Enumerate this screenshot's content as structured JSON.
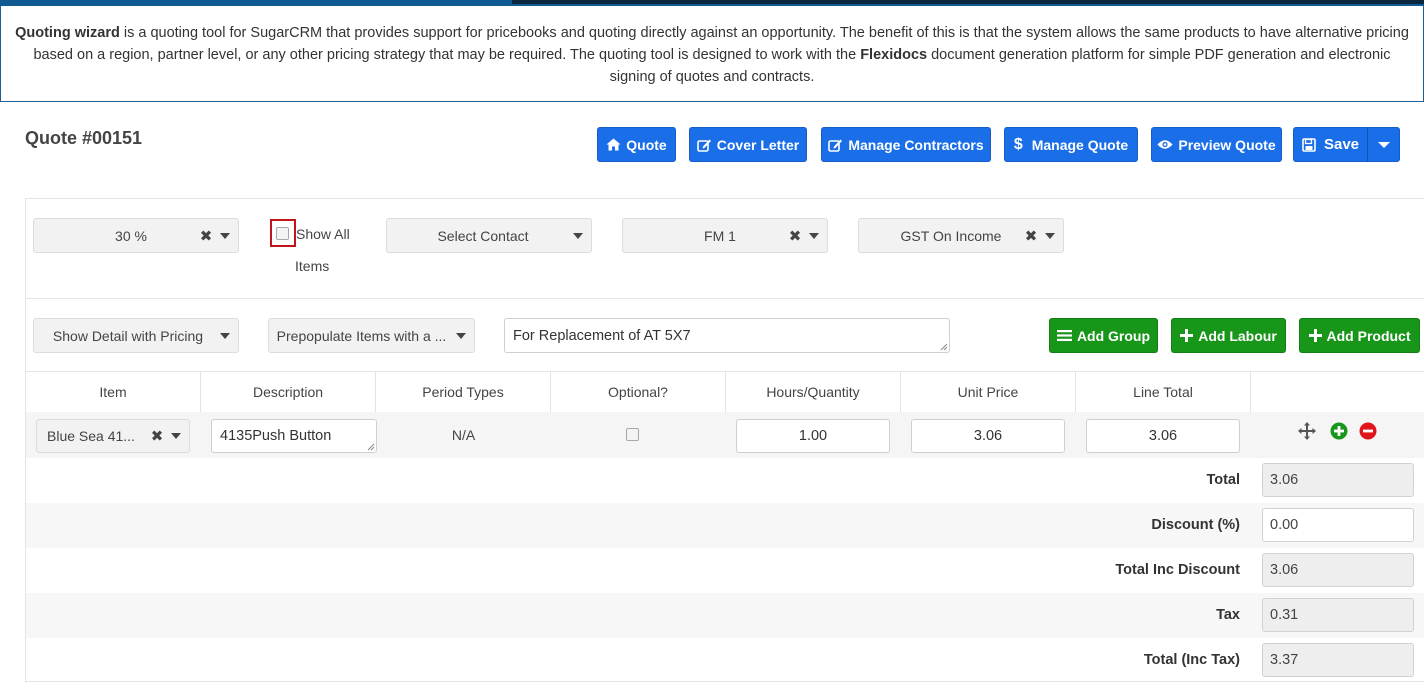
{
  "intro": {
    "b1": "Quoting wizard",
    "t1": " is a quoting tool for SugarCRM that provides support for pricebooks and quoting directly against an opportunity. The benefit of this is that the system allows the same products to have alternative pricing based on a region, partner level, or any other pricing strategy that may be required. The quoting tool is designed to work with the ",
    "b2": "Flexidocs",
    "t2": " document generation platform for simple PDF generation and electronic signing of quotes and contracts."
  },
  "quote": {
    "title": "Quote #00151"
  },
  "toolbar": {
    "quote": "Quote",
    "cover_letter": "Cover Letter",
    "manage_contractors": "Manage Contractors",
    "manage_quote": "Manage Quote",
    "preview_quote": "Preview Quote",
    "save": "Save"
  },
  "filters": {
    "percent": "30 %",
    "show_all": "Show All",
    "items": "Items",
    "contact_placeholder": "Select Contact",
    "fm": "FM 1",
    "tax": "GST On Income"
  },
  "options": {
    "detail": "Show Detail with Pricing",
    "prepopulate": "Prepopulate Items with a ...",
    "notes": "For Replacement of AT 5X7",
    "add_group": "Add Group",
    "add_labour": "Add Labour",
    "add_product": "Add Product"
  },
  "table": {
    "headers": [
      "Item",
      "Description",
      "Period Types",
      "Optional?",
      "Hours/Quantity",
      "Unit Price",
      "Line Total"
    ],
    "row": {
      "item": "Blue Sea 41...",
      "description": "4135Push Button",
      "period": "N/A",
      "quantity": "1.00",
      "unit_price": "3.06",
      "line_total": "3.06"
    }
  },
  "totals": {
    "total_label": "Total",
    "total": "3.06",
    "discount_label": "Discount (%)",
    "discount": "0.00",
    "inc_discount_label": "Total Inc Discount",
    "inc_discount": "3.06",
    "tax_label": "Tax",
    "tax": "0.31",
    "inc_tax_label": "Total (Inc Tax)",
    "inc_tax": "3.37"
  },
  "colors": {
    "primary": "#1a6ee8",
    "success": "#17961a",
    "highlight": "#c0161b",
    "remove": "#e0141b"
  },
  "icons": [
    "home-icon",
    "edit-icon",
    "dollar-icon",
    "eye-icon",
    "floppy-icon",
    "list-icon",
    "plus-icon",
    "move-icon",
    "plus-circle-icon",
    "minus-circle-icon"
  ]
}
